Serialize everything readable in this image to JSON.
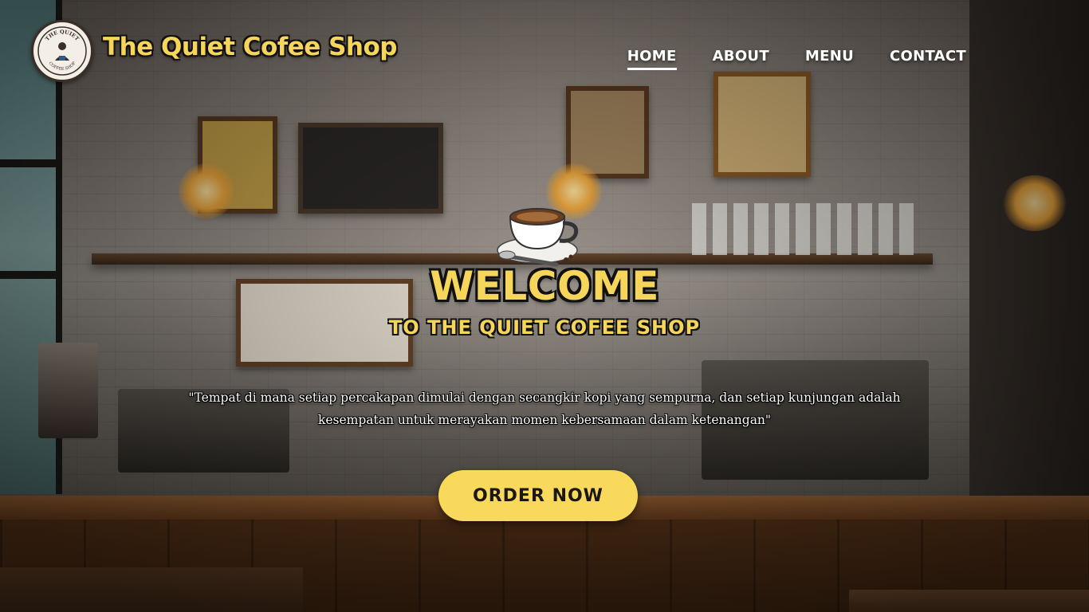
{
  "brand": {
    "name": "The Quiet Cofee Shop",
    "logo_icon": "coffee-shop-badge-logo",
    "logo_text_top": "THE QUIET",
    "logo_text_bottom": "COFFEE SHOP"
  },
  "nav": {
    "items": [
      {
        "label": "HOME",
        "active": true
      },
      {
        "label": "ABOUT",
        "active": false
      },
      {
        "label": "MENU",
        "active": false
      },
      {
        "label": "CONTACT",
        "active": false
      }
    ]
  },
  "hero": {
    "icon": "coffee-cup-icon",
    "title": "WELCOME",
    "subtitle": "TO THE QUIET COFEE SHOP",
    "quote": "\"Tempat di mana setiap percakapan dimulai dengan secangkir kopi yang sempurna, dan setiap kunjungan adalah kesempatan untuk merayakan momen kebersamaan dalam ketenangan\"",
    "cta_label": "ORDER NOW"
  },
  "colors": {
    "accent_yellow": "#f6d65a",
    "button_yellow": "#f9d95c",
    "text_white": "#ffffff",
    "outline_dark": "#111111"
  }
}
